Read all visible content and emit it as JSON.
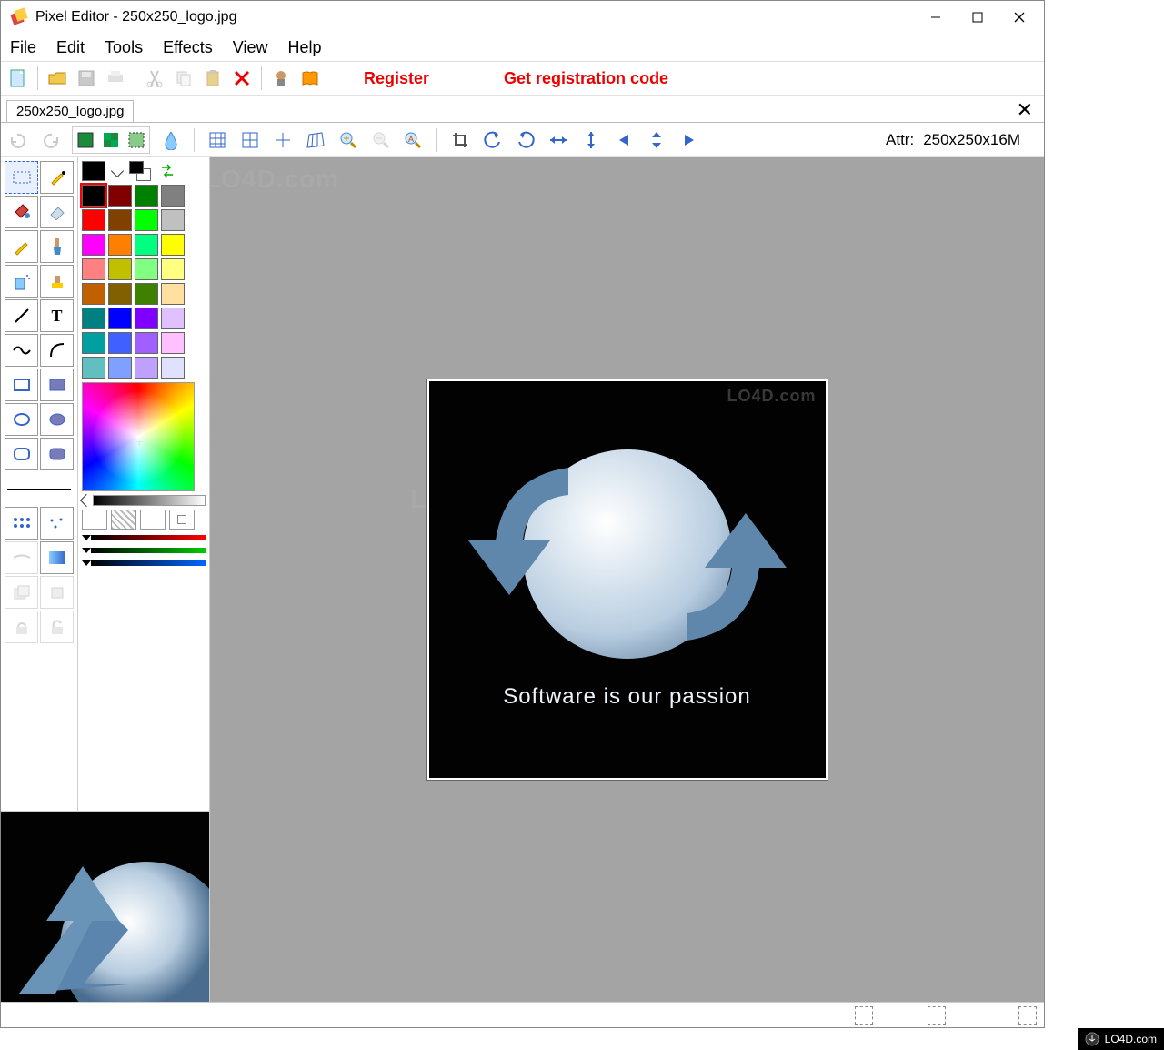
{
  "window": {
    "title": "Pixel Editor - 250x250_logo.jpg"
  },
  "menu": {
    "file": "File",
    "edit": "Edit",
    "tools": "Tools",
    "effects": "Effects",
    "view": "View",
    "help": "Help"
  },
  "toolbar1": {
    "register": "Register",
    "get_code": "Get registration code"
  },
  "tabs": {
    "current": "250x250_logo.jpg"
  },
  "toolbar2": {
    "attr_label": "Attr:",
    "attr_value": "250x250x16M"
  },
  "palette": {
    "current_fg": "#000000",
    "current_bg": "#ffffff",
    "colors": [
      "#000000",
      "#800000",
      "#008000",
      "#808080",
      "#ff0000",
      "#804000",
      "#00ff00",
      "#c0c0c0",
      "#ff00ff",
      "#ff8000",
      "#00ff80",
      "#ffff00",
      "#ff8080",
      "#c0c000",
      "#80ff80",
      "#ffff80",
      "#c06000",
      "#806000",
      "#408000",
      "#ffe0a0",
      "#008080",
      "#0000ff",
      "#8000ff",
      "#e0c0ff",
      "#00a0a0",
      "#4060ff",
      "#a060ff",
      "#ffc0ff",
      "#60c0c0",
      "#80a0ff",
      "#c0a0ff",
      "#e0e0ff"
    ]
  },
  "image": {
    "caption": "Software is our passion"
  },
  "watermark": {
    "site": "LO4D.com",
    "inpage": "LO4D.com"
  }
}
